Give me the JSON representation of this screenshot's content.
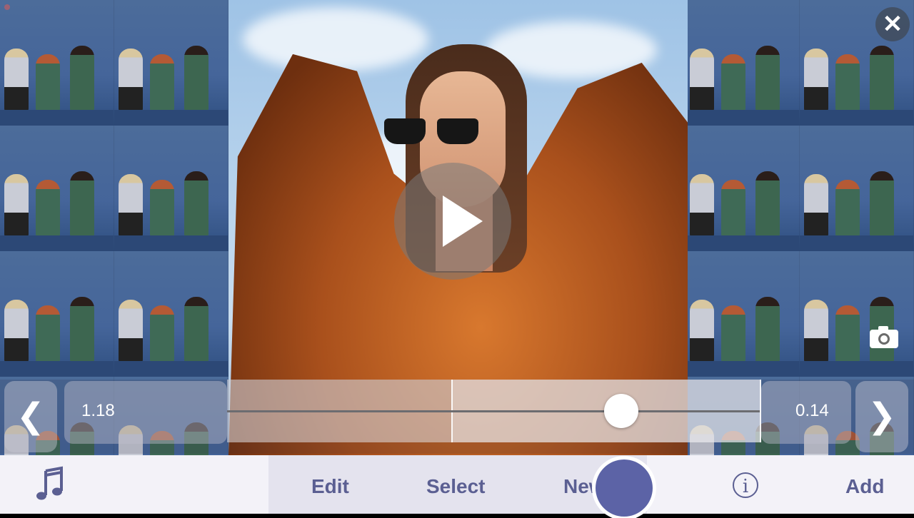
{
  "trim": {
    "start_time": "1.18",
    "end_time": "0.14",
    "left_arrow": "❮",
    "right_arrow": "❯"
  },
  "toolbar": {
    "edit_label": "Edit",
    "select_label": "Select",
    "new_label": "New",
    "add_label": "Add",
    "info_label": "i"
  },
  "icons": {
    "close": "close-icon",
    "play": "play-icon",
    "camera": "camera-icon",
    "music": "music-note-icon"
  },
  "colors": {
    "accent": "#5b5f92",
    "record": "#5c63a6",
    "toolbar_bg": "#f3f2f8"
  }
}
